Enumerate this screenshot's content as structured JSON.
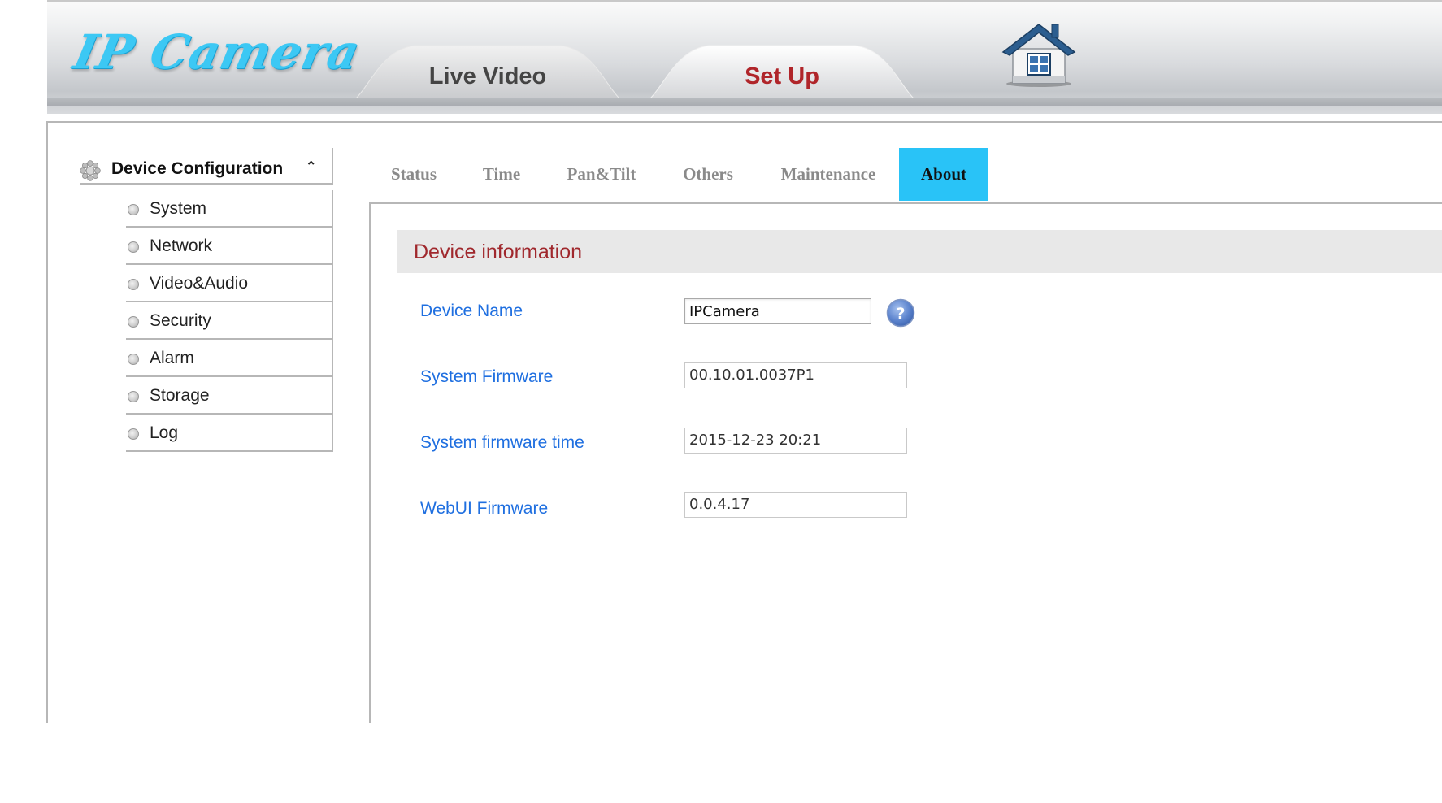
{
  "header": {
    "logo_text": "IP Camera",
    "nav_tabs": [
      {
        "label": "Live Video",
        "active": false
      },
      {
        "label": "Set Up",
        "active": true
      }
    ],
    "home_icon": "home-icon"
  },
  "sidebar": {
    "heading": "Device Configuration",
    "heading_icon": "gear-icon",
    "collapse_icon": "chevron-up-icon",
    "items": [
      {
        "label": "System"
      },
      {
        "label": "Network"
      },
      {
        "label": "Video&Audio"
      },
      {
        "label": "Security"
      },
      {
        "label": "Alarm"
      },
      {
        "label": "Storage"
      },
      {
        "label": "Log"
      }
    ]
  },
  "subtabs": [
    {
      "label": "Status",
      "active": false
    },
    {
      "label": "Time",
      "active": false
    },
    {
      "label": "Pan&Tilt",
      "active": false
    },
    {
      "label": "Others",
      "active": false
    },
    {
      "label": "Maintenance",
      "active": false
    },
    {
      "label": "About",
      "active": true
    }
  ],
  "device_info": {
    "section_title": "Device information",
    "fields": [
      {
        "label": "Device Name",
        "value": "IPCamera",
        "editable": true
      },
      {
        "label": "System Firmware",
        "value": "00.10.01.0037P1",
        "editable": false
      },
      {
        "label": "System firmware time",
        "value": "2015-12-23 20:21",
        "editable": false
      },
      {
        "label": "WebUI Firmware",
        "value": "0.0.4.17",
        "editable": false
      }
    ],
    "help_icon": "help-icon"
  },
  "colors": {
    "accent_logo": "#3cc8f4",
    "active_tab": "#29c3f7",
    "setup_tab_text": "#b0252a",
    "section_title": "#a0282d",
    "field_label": "#1f6fe0"
  }
}
